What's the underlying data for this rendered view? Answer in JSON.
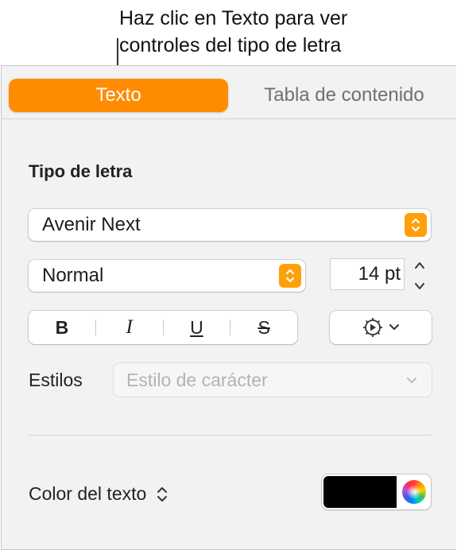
{
  "callout": {
    "line1": "Haz clic en Texto para ver",
    "line2": "controles del tipo de letra"
  },
  "tabs": [
    {
      "label": "Texto",
      "selected": true
    },
    {
      "label": "Tabla de contenido",
      "selected": false
    }
  ],
  "font_section": {
    "title": "Tipo de letra",
    "font_family": "Avenir Next",
    "font_weight": "Normal",
    "font_size": "14 pt",
    "style_buttons": {
      "bold": "B",
      "italic": "I",
      "underline": "U",
      "strikethrough": "S"
    }
  },
  "styles_row": {
    "label": "Estilos",
    "char_style_value": "Estilo de carácter"
  },
  "color_row": {
    "label": "Color del texto",
    "color": "#000000"
  },
  "colors": {
    "accent": "#ff8c00",
    "stepper": "#ff9f0a",
    "panel_bg": "#f2f2f2"
  }
}
